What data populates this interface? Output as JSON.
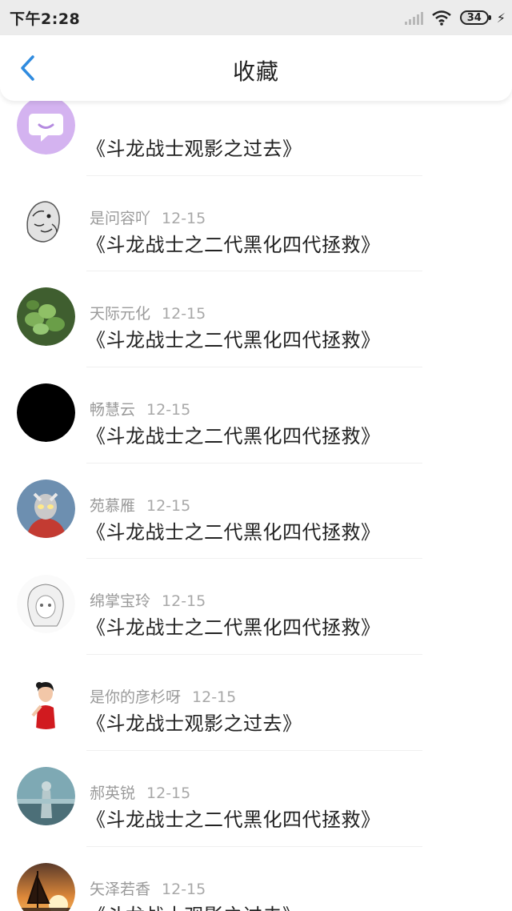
{
  "status_bar": {
    "time": "下午2:28",
    "battery": "34"
  },
  "header": {
    "title": "收藏"
  },
  "favorites": [
    {
      "user": "",
      "date": "",
      "title": "《斗龙战士观影之过去》",
      "avatar": "chat-bubble-avatar"
    },
    {
      "user": "是问容吖",
      "date": "12-15",
      "title": "《斗龙战士之二代黑化四代拯救》",
      "avatar": "lion-sketch-avatar"
    },
    {
      "user": "天际元化",
      "date": "12-15",
      "title": "《斗龙战士之二代黑化四代拯救》",
      "avatar": "green-leaves-avatar"
    },
    {
      "user": "畅慧云",
      "date": "12-15",
      "title": "《斗龙战士之二代黑化四代拯救》",
      "avatar": "black-circle-avatar"
    },
    {
      "user": "苑慕雁",
      "date": "12-15",
      "title": "《斗龙战士之二代黑化四代拯救》",
      "avatar": "ultraman-avatar"
    },
    {
      "user": "绵掌宝玲",
      "date": "12-15",
      "title": "《斗龙战士之二代黑化四代拯救》",
      "avatar": "anime-sketch-avatar"
    },
    {
      "user": "是你的彦杉呀",
      "date": "12-15",
      "title": "《斗龙战士观影之过去》",
      "avatar": "woman-red-dress-avatar"
    },
    {
      "user": "郝英锐",
      "date": "12-15",
      "title": "《斗龙战士之二代黑化四代拯救》",
      "avatar": "statue-avatar"
    },
    {
      "user": "矢泽若香",
      "date": "12-15",
      "title": "《斗龙战士观影之过去》",
      "avatar": "sunset-sailboat-avatar"
    }
  ]
}
